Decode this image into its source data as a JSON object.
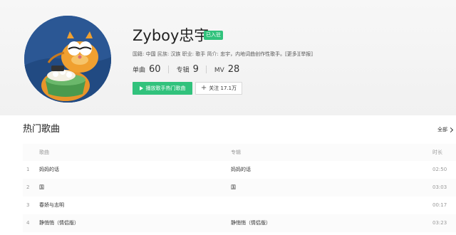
{
  "artist": {
    "name": "Zyboy忠宇",
    "badge": "已入驻",
    "intro": {
      "nationality_label": "国籍:",
      "nationality": "中国",
      "ethnicity_label": "民族:",
      "ethnicity": "汉族",
      "occupation_label": "职业:",
      "occupation": "歌手",
      "bio_label": "简介:",
      "bio": "忠宇，内地词曲创作性歌手。",
      "more": "[更多]",
      "report": "[举报]"
    },
    "stats": [
      {
        "label": "单曲",
        "value": "60"
      },
      {
        "label": "专辑",
        "value": "9"
      },
      {
        "label": "MV",
        "value": "28"
      }
    ],
    "play_button": "播放歌手热门歌曲",
    "follow_button": "关注 17.1万"
  },
  "hot_songs": {
    "title": "热门歌曲",
    "all_link": "全部",
    "columns": {
      "song": "歌曲",
      "album": "专辑",
      "duration": "时长"
    },
    "rows": [
      {
        "index": "1",
        "song": "妈妈的话",
        "album": "妈妈的话",
        "duration": "02:50"
      },
      {
        "index": "2",
        "song": "国",
        "album": "国",
        "duration": "03:03"
      },
      {
        "index": "3",
        "song": "春娇与志明",
        "album": "",
        "duration": "00:17"
      },
      {
        "index": "4",
        "song": "静悄悄（情侣版）",
        "album": "静悄悄（情侣版）",
        "duration": "03:23"
      }
    ]
  },
  "colors": {
    "accent": "#31c27c",
    "text": "#333333",
    "muted": "#999999"
  }
}
